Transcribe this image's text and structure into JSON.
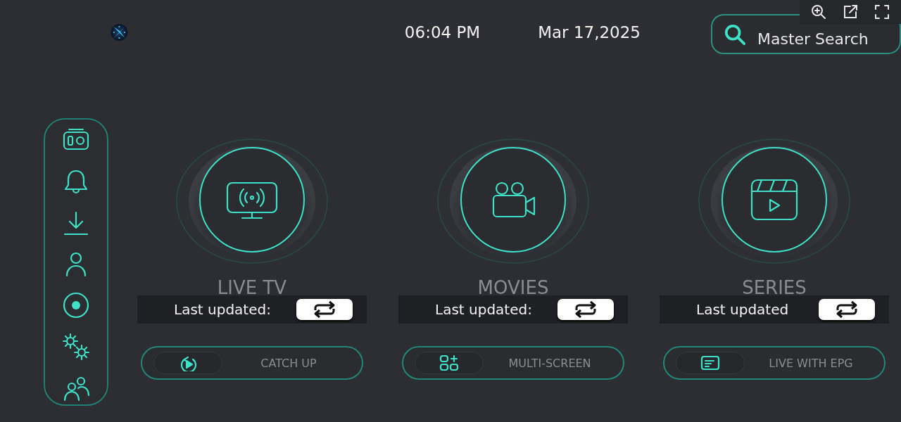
{
  "header": {
    "time": "06:04 PM",
    "date": "Mar 17,2025",
    "search": {
      "placeholder": "Master Search"
    }
  },
  "viewer_toolbar": [
    {
      "kind": "zoom"
    },
    {
      "kind": "open"
    },
    {
      "kind": "fullscreen"
    }
  ],
  "sidebar": {
    "items": [
      {
        "kind": "radio"
      },
      {
        "kind": "bell"
      },
      {
        "kind": "download"
      },
      {
        "kind": "person"
      },
      {
        "kind": "record"
      },
      {
        "kind": "gears"
      },
      {
        "kind": "people"
      }
    ]
  },
  "tiles": [
    {
      "kind": "tv",
      "title": "LIVE TV",
      "last_updated": "Last updated:",
      "action": {
        "kind": "replay",
        "label": "CATCH UP"
      }
    },
    {
      "kind": "camera",
      "title": "MOVIES",
      "last_updated": "Last updated:",
      "action": {
        "kind": "grid",
        "label": "MULTI-SCREEN"
      }
    },
    {
      "kind": "clapper",
      "title": "SERIES",
      "last_updated": "Last updated",
      "action": {
        "kind": "epg",
        "label": "LIVE WITH EPG"
      }
    }
  ]
}
